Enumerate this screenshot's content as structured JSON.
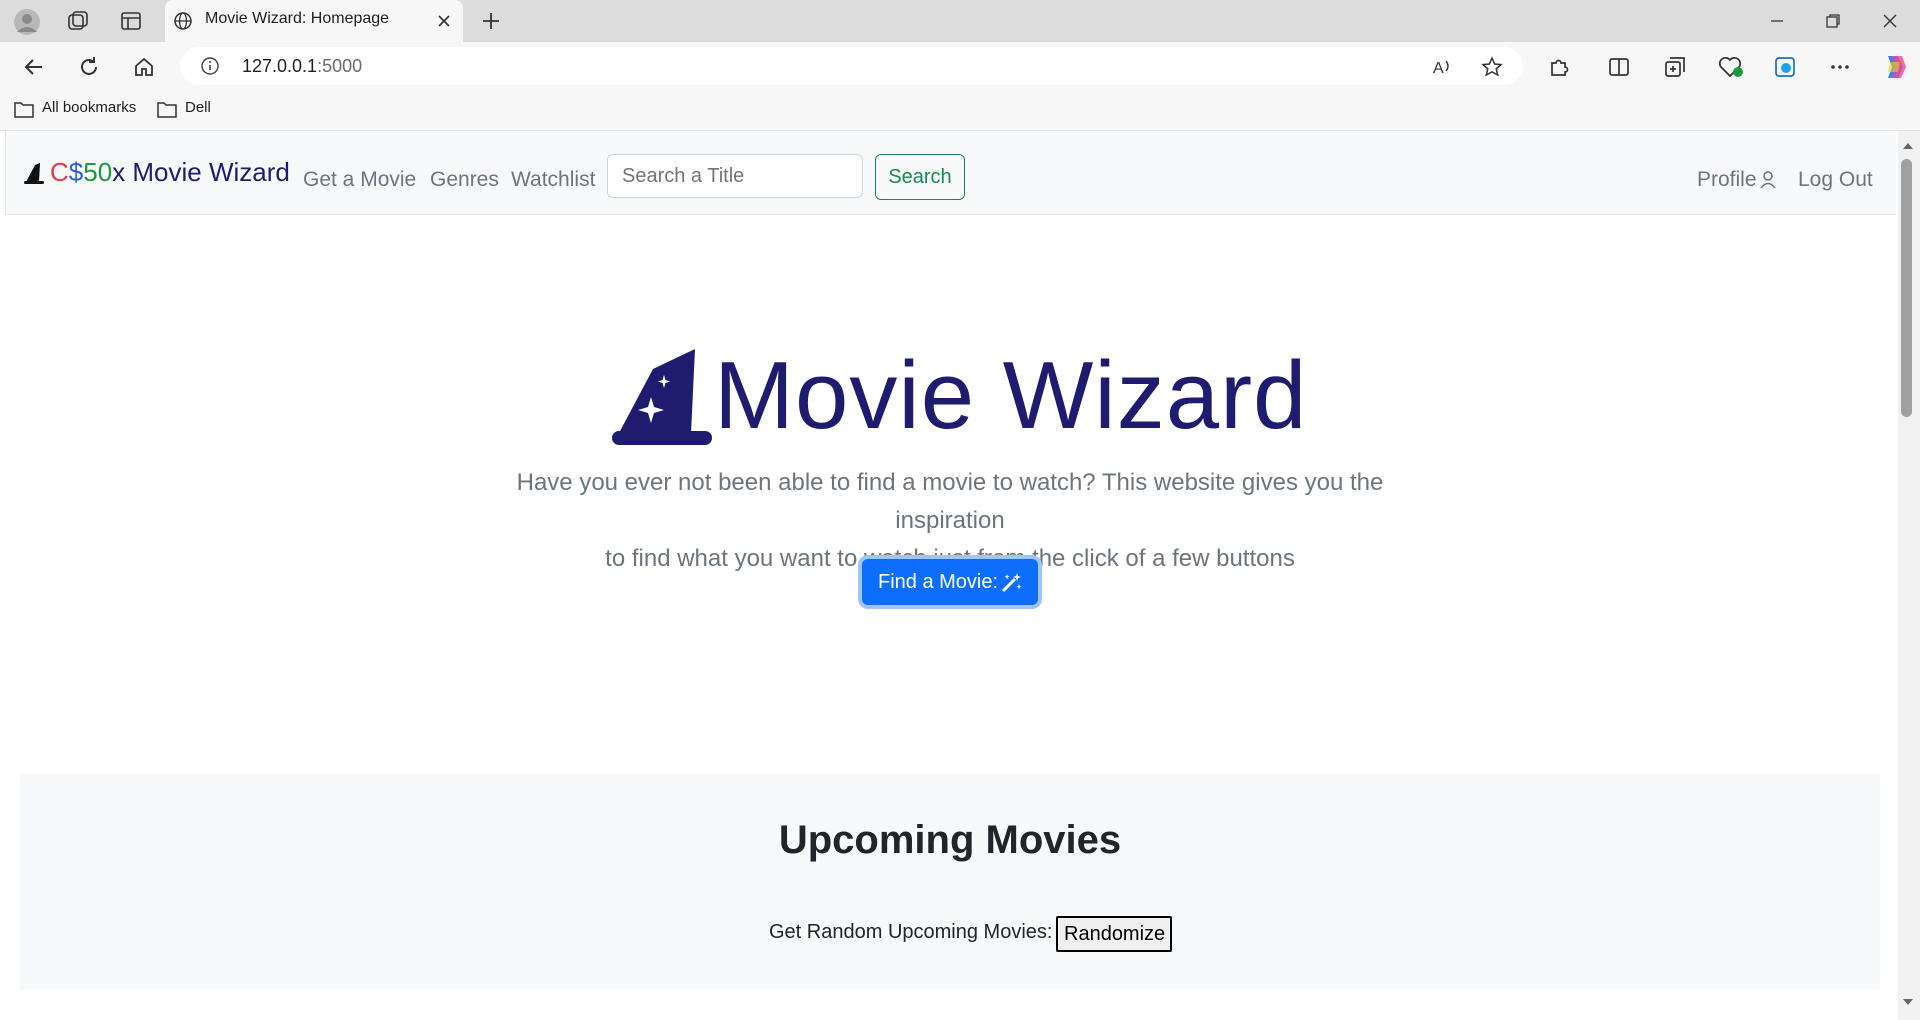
{
  "browser": {
    "tab_title": "Movie Wizard: Homepage",
    "url_host": "127.0.0.1",
    "url_port": ":5000",
    "bookmarks": [
      "All bookmarks",
      "Dell"
    ]
  },
  "navbar": {
    "brand_c": "C",
    "brand_dollar": "$",
    "brand_50": "50",
    "brand_rest": "x Movie Wizard",
    "links": [
      "Get a Movie",
      "Genres",
      "Watchlist"
    ],
    "search_placeholder": "Search a Title",
    "search_button": "Search",
    "profile": "Profile",
    "logout": "Log Out"
  },
  "hero": {
    "title": "Movie Wizard",
    "subtitle_line1": "Have you ever not been able to find a movie to watch? This website gives you the inspiration",
    "subtitle_line2": "to find what you want to watch just from the click of a few buttons",
    "button": "Find a Movie:"
  },
  "upcoming": {
    "title": "Upcoming Movies",
    "label": "Get Random Upcoming Movies:",
    "button": "Randomize"
  },
  "colors": {
    "brand": "#1f1b6e",
    "primary": "#0d6efd",
    "success": "#198754"
  }
}
